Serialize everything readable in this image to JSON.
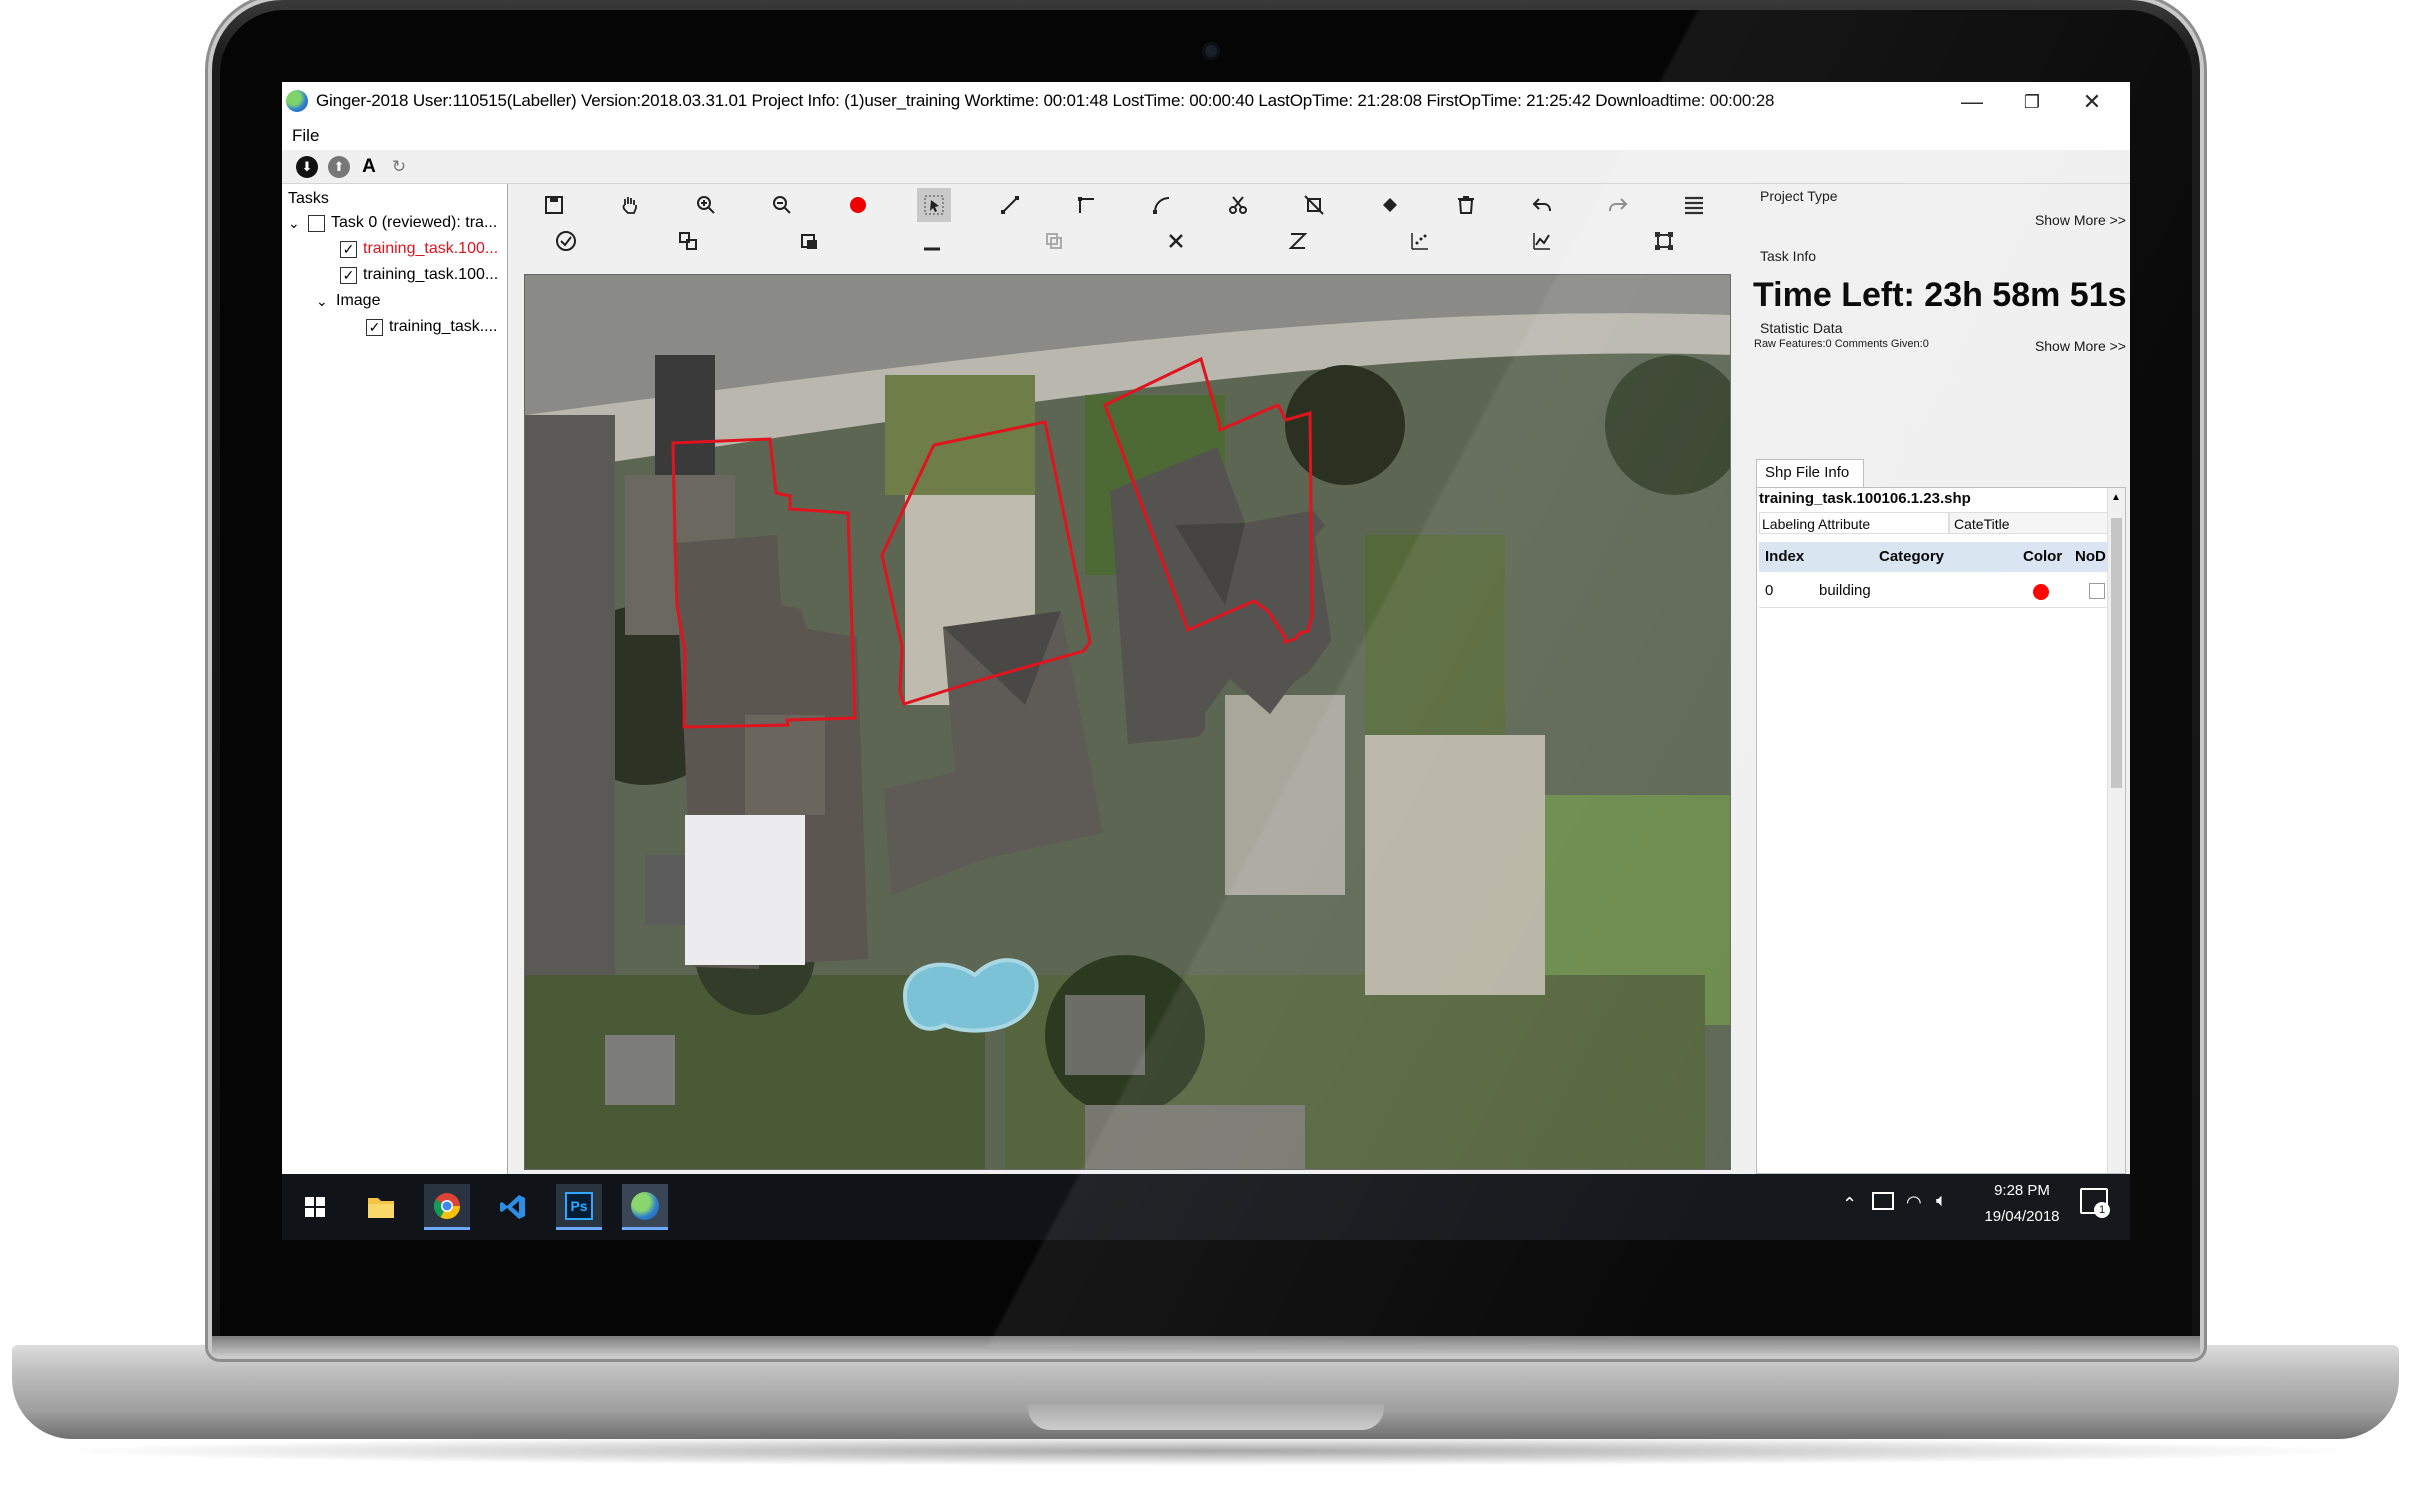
{
  "window": {
    "title": "Ginger-2018   User:110515(Labeller)    Version:2018.03.31.01   Project Info: (1)user_training   Worktime: 00:01:48   LostTime: 00:00:40   LastOpTime: 21:28:08   FirstOpTime: 21:25:42   Downloadtime: 00:00:28",
    "controls": {
      "minimize": "—",
      "restore": "❐",
      "close": "✕"
    }
  },
  "menu": {
    "file": "File"
  },
  "quickbar": {
    "text_tool": "A"
  },
  "tasks": {
    "header": "Tasks",
    "task0": "Task 0 (reviewed): tra...",
    "file1": "training_task.100...",
    "file2": "training_task.100...",
    "image_group": "Image",
    "image_file": "training_task...."
  },
  "toolbar": {
    "row1": [
      "save-icon",
      "hand-icon",
      "zoom-in-icon",
      "zoom-out-icon",
      "record-icon",
      "select-icon",
      "line-icon",
      "corner-icon",
      "curve-icon",
      "cut-icon",
      "split-icon",
      "fill-icon",
      "delete-icon",
      "undo-icon",
      "redo-icon",
      "menu-icon"
    ],
    "row2": [
      "check-icon",
      "snap-icon",
      "layer-icon",
      "baseline-icon",
      "copy-icon",
      "cross-icon",
      "rotate-icon",
      "scatter-icon",
      "polyline-icon",
      "square-vertex-icon"
    ]
  },
  "right_panel": {
    "project_type": "Project Type",
    "show_more": "Show More >>",
    "task_info": "Task Info",
    "time_left": "Time Left: 23h 58m 51s",
    "statistic_data": "Statistic Data",
    "raw_features": "Raw Features:0  Comments Given:0",
    "show_more_2": "Show More >>",
    "shp_tab": "Shp File Info",
    "shp_filename": "training_task.100106.1.23.shp",
    "labeling_attribute": "Labeling Attribute",
    "attribute_value": "CateTitle",
    "columns": {
      "index": "Index",
      "category": "Category",
      "color": "Color",
      "nod": "NoD"
    },
    "rows": [
      {
        "index": "0",
        "category": "building",
        "color": "#ff0000"
      }
    ]
  },
  "taskbar": {
    "apps": [
      "windows-start-icon",
      "file-explorer-icon",
      "chrome-icon",
      "vscode-icon",
      "photoshop-icon",
      "ginger-app-icon"
    ],
    "photoshop_label": "Ps",
    "time": "9:28 PM",
    "date": "19/04/2018",
    "notification_count": "1"
  },
  "colors": {
    "annotation": "#e0141e",
    "accent": "#6aa9ff"
  }
}
